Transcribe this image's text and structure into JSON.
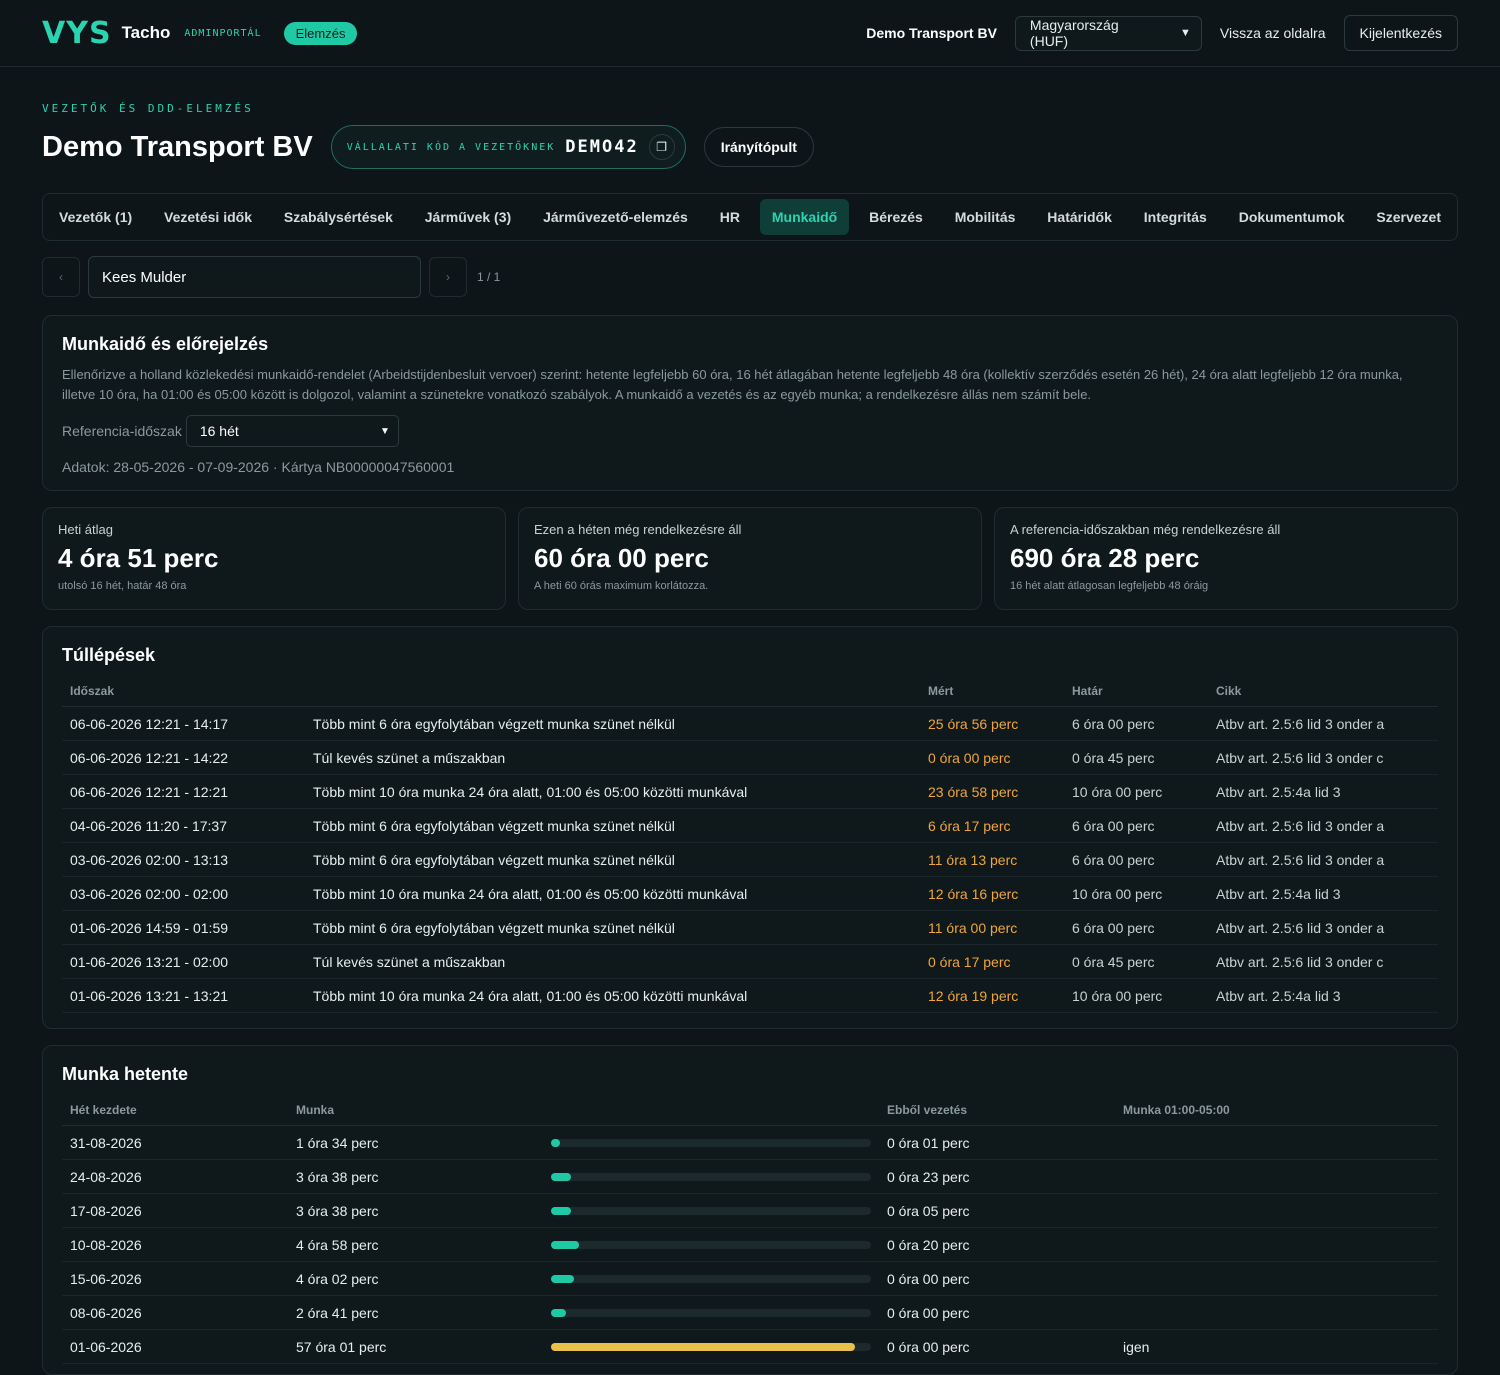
{
  "header": {
    "logo_v": "V",
    "logo_ys": "YS",
    "brand": "Tacho",
    "brand_sub": "ADMINPORTÁL",
    "badge": "Elemzés",
    "company": "Demo Transport BV",
    "country_select": "Magyarország (HUF)",
    "back_link": "Vissza az oldalra",
    "logout": "Kijelentkezés"
  },
  "page": {
    "eyebrow": "VEZETŐK ÉS DDD-ELEMZÉS",
    "title": "Demo Transport BV",
    "code_label": "VÁLLALATI KÓD A VEZETŐKNEK",
    "code_value": "DEMO42",
    "dashboard": "Irányítópult"
  },
  "tabs": [
    {
      "label": "Vezetők (1)"
    },
    {
      "label": "Vezetési idők"
    },
    {
      "label": "Szabálysértések"
    },
    {
      "label": "Járművek (3)"
    },
    {
      "label": "Járművezető-elemzés"
    },
    {
      "label": "HR"
    },
    {
      "label": "Munkaidő",
      "active": true
    },
    {
      "label": "Bérezés"
    },
    {
      "label": "Mobilitás"
    },
    {
      "label": "Határidők"
    },
    {
      "label": "Integritás"
    },
    {
      "label": "Dokumentumok"
    },
    {
      "label": "Szervezet"
    }
  ],
  "driver": {
    "name": "Kees Mulder",
    "pager": "1 / 1"
  },
  "forecast": {
    "title": "Munkaidő és előrejelzés",
    "description": "Ellenőrizve a holland közlekedési munkaidő-rendelet (Arbeidstijdenbesluit vervoer) szerint: hetente legfeljebb 60 óra, 16 hét átlagában hetente legfeljebb 48 óra (kollektív szerződés esetén 26 hét), 24 óra alatt legfeljebb 12 óra munka, illetve 10 óra, ha 01:00 és 05:00 között is dolgozol, valamint a szünetekre vonatkozó szabályok. A munkaidő a vezetés és az egyéb munka; a rendelkezésre állás nem számít bele.",
    "ref_label": "Referencia-időszak",
    "ref_value": "16 hét",
    "data_line": "Adatok: 28-05-2026 - 07-09-2026 · Kártya NB00000047560001"
  },
  "stats": [
    {
      "label": "Heti átlag",
      "value": "4 óra 51 perc",
      "sub": "utolsó 16 hét, határ 48 óra"
    },
    {
      "label": "Ezen a héten még rendelkezésre áll",
      "value": "60 óra 00 perc",
      "sub": "A heti 60 órás maximum korlátozza."
    },
    {
      "label": "A referencia-időszakban még rendelkezésre áll",
      "value": "690 óra 28 perc",
      "sub": "16 hét alatt átlagosan legfeljebb 48 óráig"
    }
  ],
  "overs": {
    "title": "Túllépések",
    "columns": [
      "Időszak",
      "",
      "Mért",
      "Határ",
      "Cikk"
    ],
    "rows": [
      [
        "06-06-2026 12:21 - 14:17",
        "Több mint 6 óra egyfolytában végzett munka szünet nélkül",
        "25 óra 56 perc",
        "6 óra 00 perc",
        "Atbv art. 2.5:6 lid 3 onder a"
      ],
      [
        "06-06-2026 12:21 - 14:22",
        "Túl kevés szünet a műszakban",
        "0 óra 00 perc",
        "0 óra 45 perc",
        "Atbv art. 2.5:6 lid 3 onder c"
      ],
      [
        "06-06-2026 12:21 - 12:21",
        "Több mint 10 óra munka 24 óra alatt, 01:00 és 05:00 közötti munkával",
        "23 óra 58 perc",
        "10 óra 00 perc",
        "Atbv art. 2.5:4a lid 3"
      ],
      [
        "04-06-2026 11:20 - 17:37",
        "Több mint 6 óra egyfolytában végzett munka szünet nélkül",
        "6 óra 17 perc",
        "6 óra 00 perc",
        "Atbv art. 2.5:6 lid 3 onder a"
      ],
      [
        "03-06-2026 02:00 - 13:13",
        "Több mint 6 óra egyfolytában végzett munka szünet nélkül",
        "11 óra 13 perc",
        "6 óra 00 perc",
        "Atbv art. 2.5:6 lid 3 onder a"
      ],
      [
        "03-06-2026 02:00 - 02:00",
        "Több mint 10 óra munka 24 óra alatt, 01:00 és 05:00 közötti munkával",
        "12 óra 16 perc",
        "10 óra 00 perc",
        "Atbv art. 2.5:4a lid 3"
      ],
      [
        "01-06-2026 14:59 - 01:59",
        "Több mint 6 óra egyfolytában végzett munka szünet nélkül",
        "11 óra 00 perc",
        "6 óra 00 perc",
        "Atbv art. 2.5:6 lid 3 onder a"
      ],
      [
        "01-06-2026 13:21 - 02:00",
        "Túl kevés szünet a műszakban",
        "0 óra 17 perc",
        "0 óra 45 perc",
        "Atbv art. 2.5:6 lid 3 onder c"
      ],
      [
        "01-06-2026 13:21 - 13:21",
        "Több mint 10 óra munka 24 óra alatt, 01:00 és 05:00 közötti munkával",
        "12 óra 19 perc",
        "10 óra 00 perc",
        "Atbv art. 2.5:4a lid 3"
      ]
    ]
  },
  "weekly": {
    "title": "Munka hetente",
    "columns": [
      "Hét kezdete",
      "Munka",
      "",
      "Ebből vezetés",
      "Munka 01:00-05:00"
    ],
    "rows": [
      {
        "week": "31-08-2026",
        "work": "1 óra 34 perc",
        "fraction": 0.027,
        "driving": "0 óra 01 perc",
        "night": ""
      },
      {
        "week": "24-08-2026",
        "work": "3 óra 38 perc",
        "fraction": 0.064,
        "driving": "0 óra 23 perc",
        "night": ""
      },
      {
        "week": "17-08-2026",
        "work": "3 óra 38 perc",
        "fraction": 0.064,
        "driving": "0 óra 05 perc",
        "night": ""
      },
      {
        "week": "10-08-2026",
        "work": "4 óra 58 perc",
        "fraction": 0.087,
        "driving": "0 óra 20 perc",
        "night": ""
      },
      {
        "week": "15-06-2026",
        "work": "4 óra 02 perc",
        "fraction": 0.071,
        "driving": "0 óra 00 perc",
        "night": ""
      },
      {
        "week": "08-06-2026",
        "work": "2 óra 41 perc",
        "fraction": 0.047,
        "driving": "0 óra 00 perc",
        "night": ""
      },
      {
        "week": "01-06-2026",
        "work": "57 óra 01 perc",
        "fraction": 0.95,
        "warn": true,
        "driving": "0 óra 00 perc",
        "night": "igen"
      }
    ]
  },
  "colors": {
    "accent": "#20c9a6",
    "warn": "#f0a63a",
    "bar_warn": "#e8c14a"
  },
  "icons": {
    "copy": "copy-icon",
    "prev": "chevron-left-icon",
    "next": "chevron-right-icon",
    "select": "chevron-down-icon"
  }
}
